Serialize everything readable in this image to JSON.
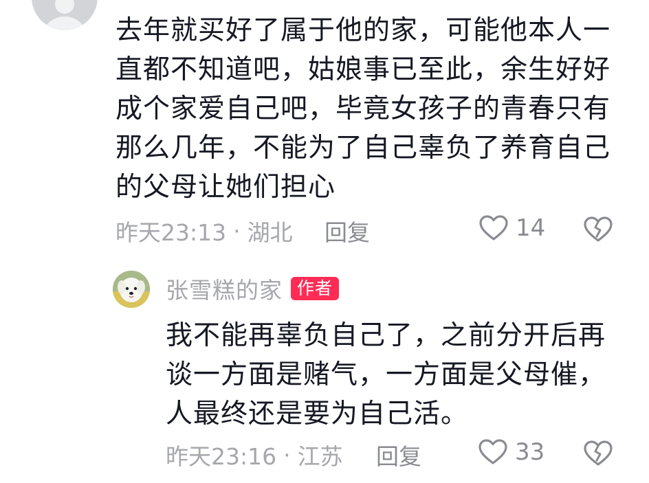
{
  "comment": {
    "text": "去年就买好了属于他的家，可能他本人一\n直都不知道吧，姑娘事已至此，余生好好\n成个家爱自己吧，毕竟女孩子的青春只有\n那么几年，不能为了自己辜负了养育自己\n的父母让她们担心",
    "time": "昨天23:13",
    "separator": "·",
    "location": "湖北",
    "reply_label": "回复",
    "like_count": "14",
    "like_icon": "heart-outline-icon",
    "dislike_icon": "broken-heart-icon"
  },
  "reply": {
    "username": "张雪糕的家",
    "badge": "作者",
    "text": "我不能再辜负自己了，之前分开后再\n谈一方面是赌气，一方面是父母催，\n人最终还是要为自己活。",
    "time": "昨天23:16",
    "separator": "·",
    "location": "江苏",
    "reply_label": "回复",
    "like_count": "33",
    "like_icon": "heart-outline-icon",
    "dislike_icon": "broken-heart-icon"
  },
  "colors": {
    "text_primary": "#161823",
    "text_secondary": "#a6a7ab",
    "badge_bg": "#fe2c55",
    "icon": "#8a8b91"
  }
}
